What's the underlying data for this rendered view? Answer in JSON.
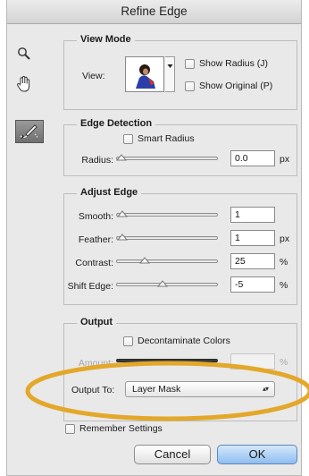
{
  "window": {
    "title": "Refine Edge"
  },
  "tools": [
    "zoom-icon",
    "hand-icon",
    "refine-radius-brush-icon"
  ],
  "view_mode": {
    "legend": "View Mode",
    "view_label": "View:",
    "show_radius": "Show Radius (J)",
    "show_original": "Show Original (P)",
    "show_radius_checked": false,
    "show_original_checked": false
  },
  "edge_detection": {
    "legend": "Edge Detection",
    "smart_radius": "Smart Radius",
    "smart_radius_checked": false,
    "radius_label": "Radius:",
    "radius_value": "0.0",
    "radius_unit": "px",
    "radius_level": 0
  },
  "adjust_edge": {
    "legend": "Adjust Edge",
    "smooth_label": "Smooth:",
    "smooth_value": "1",
    "smooth_level": 0.01,
    "feather_label": "Feather:",
    "feather_value": "1",
    "feather_unit": "px",
    "feather_level": 0.01,
    "contrast_label": "Contrast:",
    "contrast_value": "25",
    "contrast_unit": "%",
    "contrast_level": 0.25,
    "shift_label": "Shift Edge:",
    "shift_value": "-5",
    "shift_unit": "%",
    "shift_level": 0.45
  },
  "output": {
    "legend": "Output",
    "decontaminate": "Decontaminate Colors",
    "decontaminate_checked": false,
    "amount_label": "Amount:",
    "amount_unit": "%",
    "output_to_label": "Output To:",
    "output_to_value": "Layer Mask"
  },
  "remember_settings": "Remember Settings",
  "cancel_label": "Cancel",
  "ok_label": "OK",
  "colors": {
    "highlight": "#e3a82a",
    "ok_button": "#8fbdf0"
  }
}
